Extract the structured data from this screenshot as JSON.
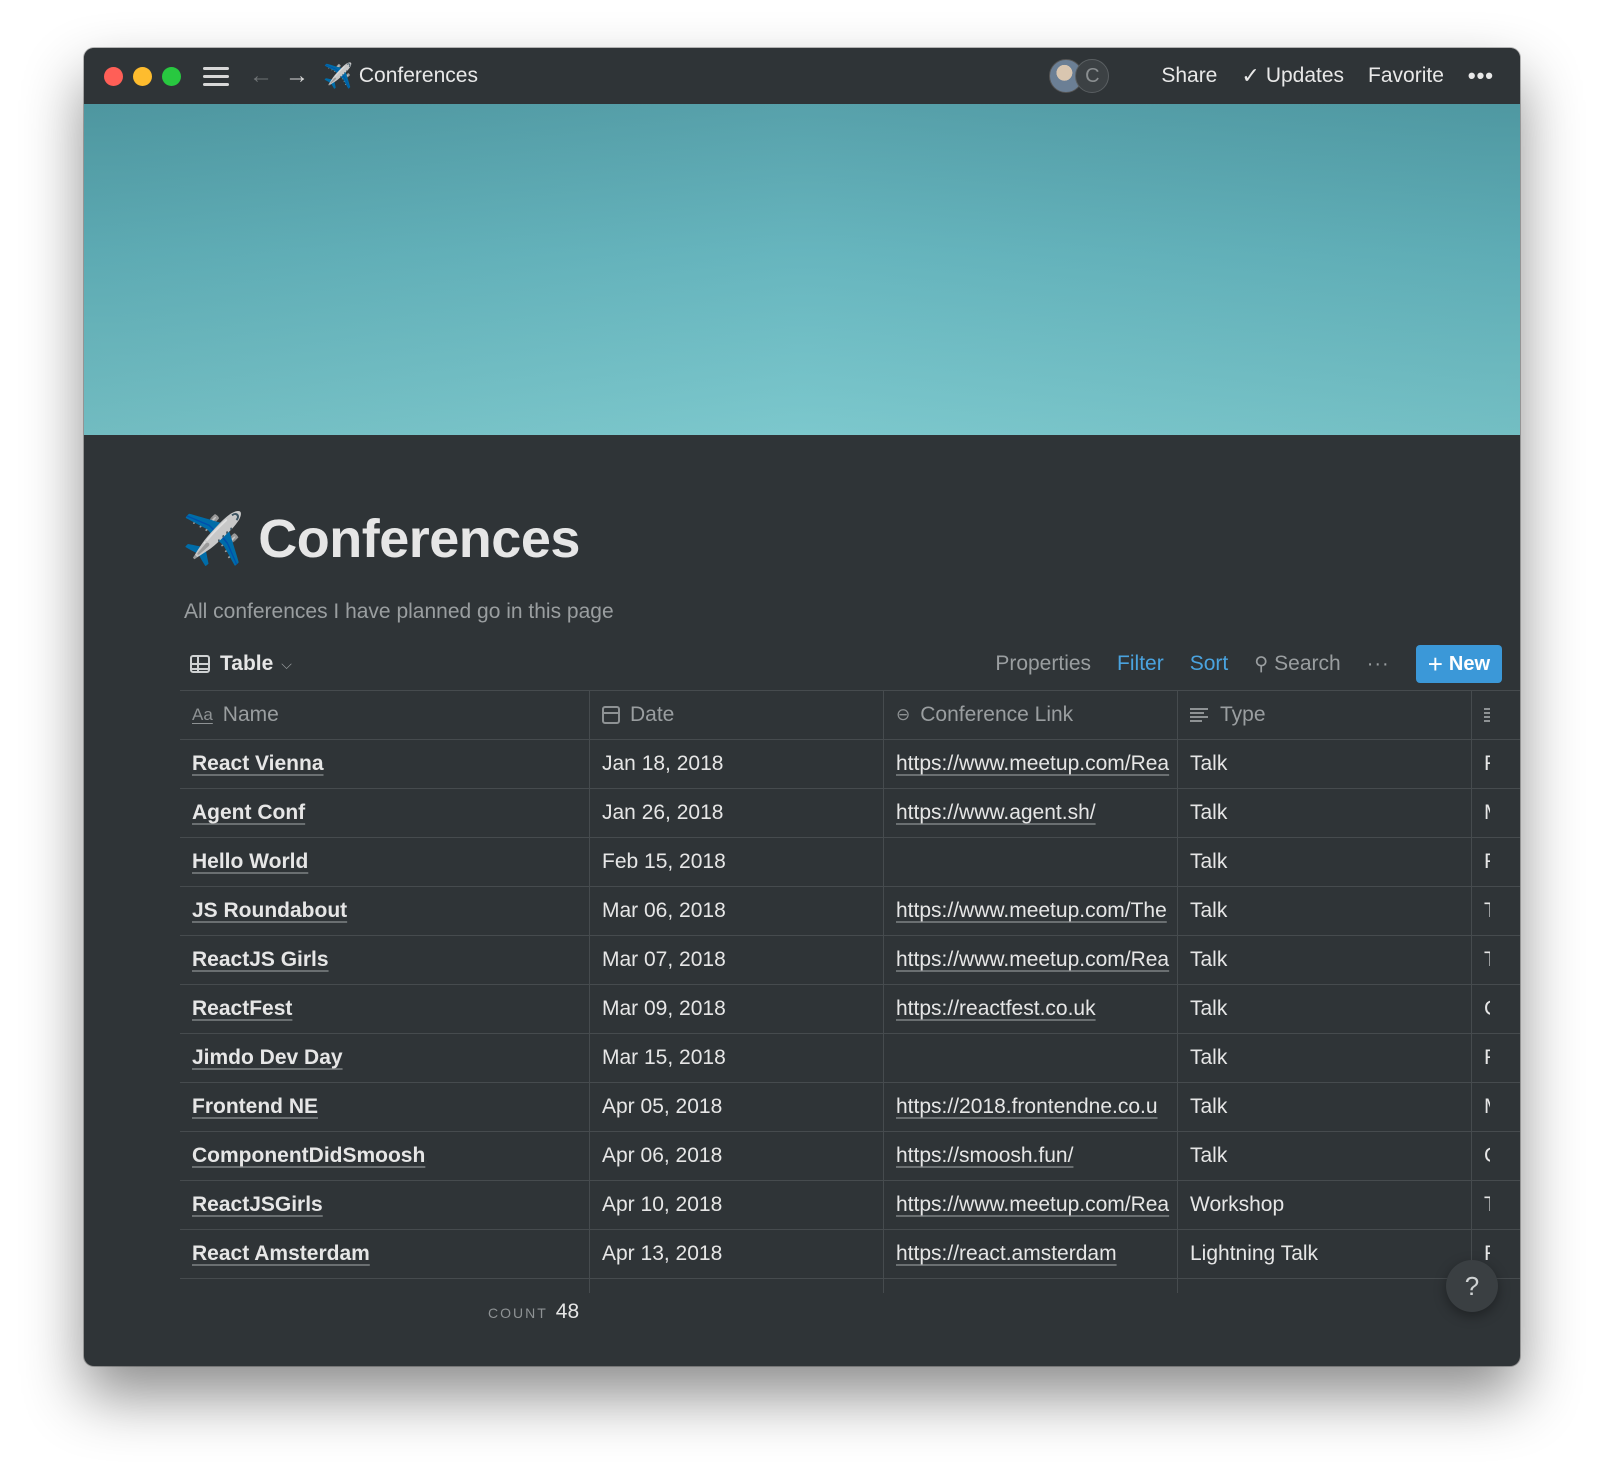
{
  "titlebar": {
    "page_emoji": "✈️",
    "page_title": "Conferences",
    "avatar_initial": "C",
    "share": "Share",
    "updates": "Updates",
    "favorite": "Favorite",
    "more": "•••"
  },
  "page": {
    "emoji": "✈️",
    "title": "Conferences",
    "description": "All conferences I have planned go in this page"
  },
  "toolbar": {
    "view_label": "Table",
    "properties": "Properties",
    "filter": "Filter",
    "sort": "Sort",
    "search": "Search",
    "more": "···",
    "new_label": "New"
  },
  "table": {
    "columns": {
      "name": "Name",
      "date": "Date",
      "link": "Conference Link",
      "type": "Type"
    },
    "rows": [
      {
        "name": "React Vienna",
        "date": "Jan 18, 2018",
        "link": "https://www.meetup.com/Rea",
        "type": "Talk",
        "extra": "F"
      },
      {
        "name": "Agent Conf",
        "date": "Jan 26, 2018",
        "link": "https://www.agent.sh/",
        "type": "Talk",
        "extra": "M"
      },
      {
        "name": "Hello World",
        "date": "Feb 15, 2018",
        "link": "",
        "type": "Talk",
        "extra": "F"
      },
      {
        "name": "JS Roundabout",
        "date": "Mar 06, 2018",
        "link": "https://www.meetup.com/The",
        "type": "Talk",
        "extra": "T"
      },
      {
        "name": "ReactJS Girls",
        "date": "Mar 07, 2018",
        "link": "https://www.meetup.com/Rea",
        "type": "Talk",
        "extra": "T"
      },
      {
        "name": "ReactFest",
        "date": "Mar 09, 2018",
        "link": "https://reactfest.co.uk",
        "type": "Talk",
        "extra": "C"
      },
      {
        "name": "Jimdo Dev Day",
        "date": "Mar 15, 2018",
        "link": "",
        "type": "Talk",
        "extra": "F"
      },
      {
        "name": "Frontend NE",
        "date": "Apr 05, 2018",
        "link": "https://2018.frontendne.co.u",
        "type": "Talk",
        "extra": "M"
      },
      {
        "name": "ComponentDidSmoosh",
        "date": "Apr 06, 2018",
        "link": "https://smoosh.fun/",
        "type": "Talk",
        "extra": "C"
      },
      {
        "name": "ReactJSGirls",
        "date": "Apr 10, 2018",
        "link": "https://www.meetup.com/Rea",
        "type": "Workshop",
        "extra": "T"
      },
      {
        "name": "React Amsterdam",
        "date": "Apr 13, 2018",
        "link": "https://react.amsterdam",
        "type": "Lightning Talk",
        "extra": "F"
      }
    ]
  },
  "footer": {
    "count_label": "COUNT",
    "count_value": "48",
    "help": "?"
  }
}
